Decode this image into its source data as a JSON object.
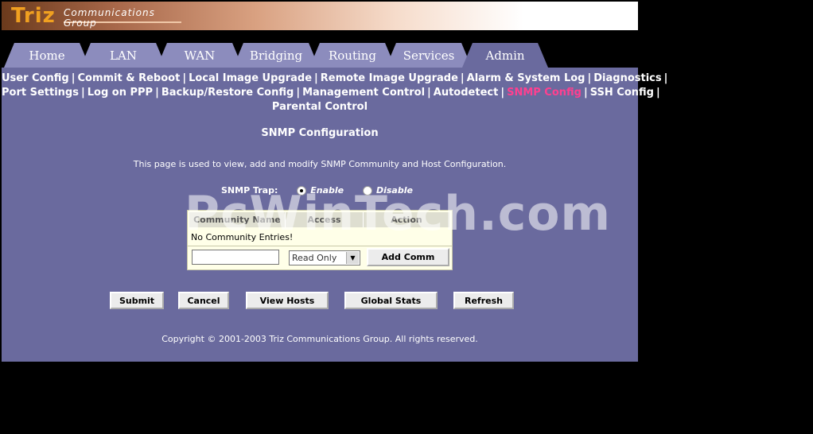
{
  "brand": {
    "logo_word": "Triz",
    "logo_line1": "Communications",
    "logo_line2": "Group"
  },
  "tabs": [
    {
      "label": "Home",
      "active": false
    },
    {
      "label": "LAN",
      "active": false
    },
    {
      "label": "WAN",
      "active": false
    },
    {
      "label": "Bridging",
      "active": false
    },
    {
      "label": "Routing",
      "active": false
    },
    {
      "label": "Services",
      "active": false
    },
    {
      "label": "Admin",
      "active": true
    }
  ],
  "subnav": {
    "row1": [
      "User Config",
      "Commit & Reboot",
      "Local Image Upgrade",
      "Remote Image Upgrade",
      "Alarm & System Log",
      "Diagnostics"
    ],
    "row2": [
      "Port Settings",
      "Log on PPP",
      "Backup/Restore Config",
      "Management Control",
      "Autodetect",
      "SNMP Config",
      "SSH Config"
    ],
    "row3": [
      "Parental Control"
    ],
    "current": "SNMP Config",
    "separator": "|"
  },
  "page": {
    "title": "SNMP Configuration",
    "description": "This page is used to view, add and modify SNMP Community and Host Configuration."
  },
  "trap": {
    "label": "SNMP Trap:",
    "enable_label": "Enable",
    "disable_label": "Disable",
    "selected": "Enable"
  },
  "community_table": {
    "headers": [
      "Community Name",
      "Access",
      "Action"
    ],
    "empty_message": "No Community Entries!",
    "input_value": "",
    "access_selected": "Read Only",
    "add_button": "Add Comm"
  },
  "actions": {
    "submit": "Submit",
    "cancel": "Cancel",
    "view_hosts": "View Hosts",
    "global_stats": "Global Stats",
    "refresh": "Refresh"
  },
  "footer": {
    "copyright": "Copyright © 2001-2003 Triz Communications Group. All rights reserved."
  },
  "watermark": "PcWinTech.com",
  "colors": {
    "panel": "#6a6a9e",
    "tab": "#8c8cbd",
    "current_link": "#ff4090",
    "logo": "#f0a020"
  }
}
